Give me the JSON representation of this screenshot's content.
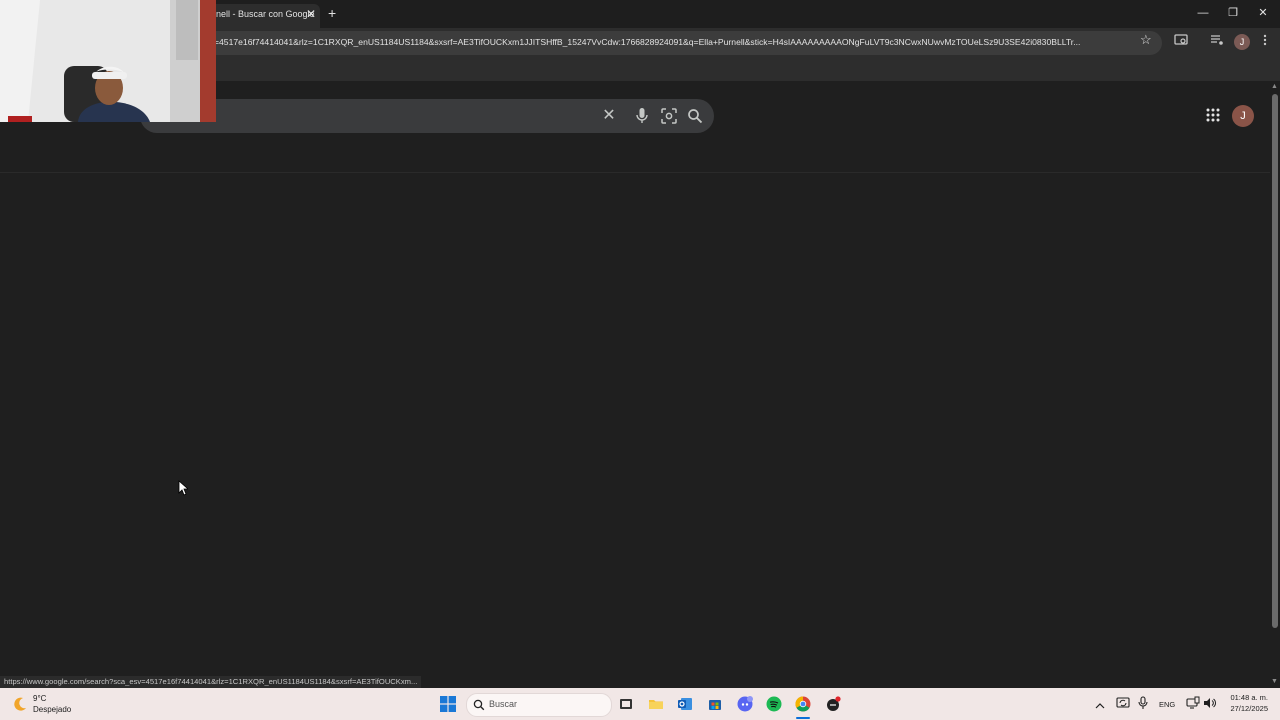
{
  "browser": {
    "tab": {
      "title": "nell - Buscar con Google",
      "close_glyph": "✕"
    },
    "new_tab_glyph": "+",
    "window_controls": {
      "minimize": "—",
      "restore": "❐",
      "close": "✕"
    },
    "url": "=4517e16f74414041&rlz=1C1RXQR_enUS1184US1184&sxsrf=AE3TifOUCKxm1JJITSHffB_15247VvCdw:1766828924091&q=Ella+Purnell&stick=H4sIAAAAAAAAAONgFuLVT9c3NCwxNUwvMzTOUeLSz9U3SE42i0830BLLTr...",
    "bookmark_glyph": "☆",
    "profile_initial": "J",
    "status_url": "https://www.google.com/search?sca_esv=4517e16f74414041&rlz=1C1RXQR_enUS1184US1184&sxsrf=AE3TifOUCKxm..."
  },
  "google": {
    "search_value": "",
    "clear_glyph": "✕",
    "avatar_initial": "J"
  },
  "taskbar": {
    "weather": {
      "temp": "9°C",
      "desc": "Despejado"
    },
    "search_label": "Buscar",
    "tray": {
      "chevron": "^",
      "language": "ENG",
      "time": "01:48 a. m.",
      "date": "27/12/2025"
    },
    "pinned": [
      "windows-start",
      "task-view",
      "file-explorer",
      "outlook",
      "microsoft-store",
      "discord",
      "spotify",
      "chrome",
      "other-app"
    ]
  },
  "colors": {
    "page_bg": "#1f1f1f",
    "search_box": "#3a3b3d",
    "taskbar_bg": "#f1e7e6",
    "accent_blue": "#0a6fd8"
  }
}
